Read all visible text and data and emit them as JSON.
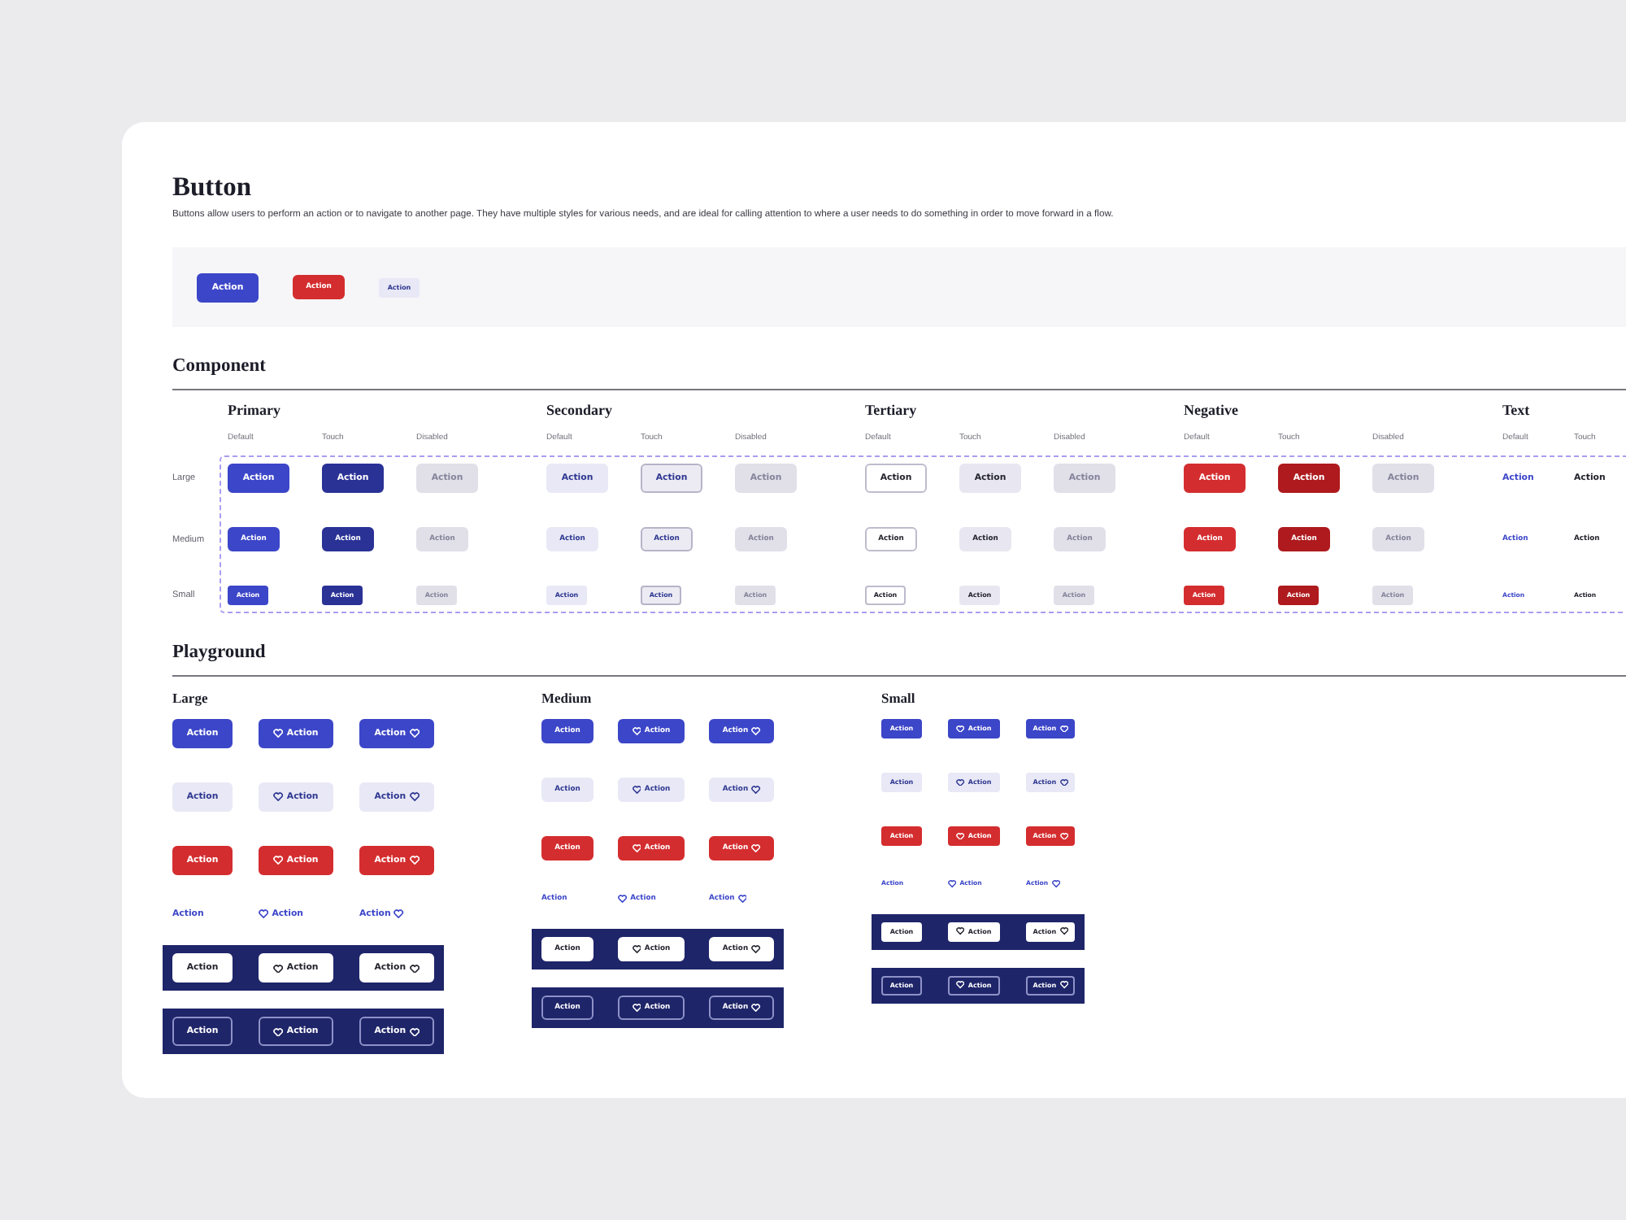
{
  "title": "Button",
  "description": "Buttons allow users to perform an action or to navigate to another page. They have multiple styles for various needs, and are ideal for calling attention to where a user needs to do something in order to move forward in a flow.",
  "preview": {
    "buttons": [
      {
        "label": "Action",
        "kind": "primary_large"
      },
      {
        "label": "Action",
        "kind": "negative_medium"
      },
      {
        "label": "Action",
        "kind": "secondary_small"
      }
    ]
  },
  "component": {
    "heading": "Component",
    "sizes": [
      {
        "label": "Large",
        "kind": "large"
      },
      {
        "label": "Medium",
        "kind": "medium"
      },
      {
        "label": "Small",
        "kind": "small"
      }
    ],
    "groups": [
      {
        "title": "Primary",
        "kind": "primary",
        "columns": [
          {
            "label": "Default",
            "kind": "default",
            "buttons": [
              "Action",
              "Action",
              "Action"
            ]
          },
          {
            "label": "Touch",
            "kind": "touch",
            "buttons": [
              "Action",
              "Action",
              "Action"
            ]
          },
          {
            "label": "Disabled",
            "kind": "disabled",
            "buttons": [
              "Action",
              "Action",
              "Action"
            ]
          }
        ]
      },
      {
        "title": "Secondary",
        "kind": "secondary",
        "columns": [
          {
            "label": "Default",
            "kind": "default",
            "buttons": [
              "Action",
              "Action",
              "Action"
            ]
          },
          {
            "label": "Touch",
            "kind": "touch",
            "buttons": [
              "Action",
              "Action",
              "Action"
            ]
          },
          {
            "label": "Disabled",
            "kind": "disabled",
            "buttons": [
              "Action",
              "Action",
              "Action"
            ]
          }
        ]
      },
      {
        "title": "Tertiary",
        "kind": "tertiary",
        "columns": [
          {
            "label": "Default",
            "kind": "default",
            "buttons": [
              "Action",
              "Action",
              "Action"
            ]
          },
          {
            "label": "Touch",
            "kind": "touch",
            "buttons": [
              "Action",
              "Action",
              "Action"
            ]
          },
          {
            "label": "Disabled",
            "kind": "disabled",
            "buttons": [
              "Action",
              "Action",
              "Action"
            ]
          }
        ]
      },
      {
        "title": "Negative",
        "kind": "negative",
        "columns": [
          {
            "label": "Default",
            "kind": "default",
            "buttons": [
              "Action",
              "Action",
              "Action"
            ]
          },
          {
            "label": "Touch",
            "kind": "touch",
            "buttons": [
              "Action",
              "Action",
              "Action"
            ]
          },
          {
            "label": "Disabled",
            "kind": "disabled",
            "buttons": [
              "Action",
              "Action",
              "Action"
            ]
          }
        ]
      },
      {
        "title": "Text",
        "kind": "text",
        "columns": [
          {
            "label": "Default",
            "kind": "default",
            "buttons": [
              "Action",
              "Action",
              "Action"
            ]
          },
          {
            "label": "Touch",
            "kind": "touch",
            "buttons": [
              "Action",
              "Action",
              "Action"
            ]
          }
        ]
      }
    ]
  },
  "playground": {
    "heading": "Playground",
    "columns": [
      {
        "title": "Large",
        "kind": "large",
        "rows": [
          {
            "kind": "primary",
            "buttons": [
              {
                "label": "Action",
                "kind": "label_only"
              },
              {
                "label": "Action",
                "kind": "icon_left"
              },
              {
                "label": "Action",
                "kind": "icon_right"
              }
            ]
          },
          {
            "kind": "secondary",
            "buttons": [
              {
                "label": "Action",
                "kind": "label_only"
              },
              {
                "label": "Action",
                "kind": "icon_left"
              },
              {
                "label": "Action",
                "kind": "icon_right"
              }
            ]
          },
          {
            "kind": "negative",
            "buttons": [
              {
                "label": "Action",
                "kind": "label_only"
              },
              {
                "label": "Action",
                "kind": "icon_left"
              },
              {
                "label": "Action",
                "kind": "icon_right"
              }
            ]
          },
          {
            "kind": "text",
            "buttons": [
              {
                "label": "Action",
                "kind": "label_only"
              },
              {
                "label": "Action",
                "kind": "icon_left"
              },
              {
                "label": "Action",
                "kind": "icon_right"
              }
            ]
          },
          {
            "kind": "inverse",
            "buttons": [
              {
                "label": "Action",
                "kind": "label_only"
              },
              {
                "label": "Action",
                "kind": "icon_left"
              },
              {
                "label": "Action",
                "kind": "icon_right"
              }
            ]
          },
          {
            "kind": "inverse_outline",
            "buttons": [
              {
                "label": "Action",
                "kind": "label_only"
              },
              {
                "label": "Action",
                "kind": "icon_left"
              },
              {
                "label": "Action",
                "kind": "icon_right"
              }
            ]
          }
        ]
      },
      {
        "title": "Medium",
        "kind": "medium",
        "rows": [
          {
            "kind": "primary",
            "buttons": [
              {
                "label": "Action",
                "kind": "label_only"
              },
              {
                "label": "Action",
                "kind": "icon_left"
              },
              {
                "label": "Action",
                "kind": "icon_right"
              }
            ]
          },
          {
            "kind": "secondary",
            "buttons": [
              {
                "label": "Action",
                "kind": "label_only"
              },
              {
                "label": "Action",
                "kind": "icon_left"
              },
              {
                "label": "Action",
                "kind": "icon_right"
              }
            ]
          },
          {
            "kind": "negative",
            "buttons": [
              {
                "label": "Action",
                "kind": "label_only"
              },
              {
                "label": "Action",
                "kind": "icon_left"
              },
              {
                "label": "Action",
                "kind": "icon_right"
              }
            ]
          },
          {
            "kind": "text",
            "buttons": [
              {
                "label": "Action",
                "kind": "label_only"
              },
              {
                "label": "Action",
                "kind": "icon_left"
              },
              {
                "label": "Action",
                "kind": "icon_right"
              }
            ]
          },
          {
            "kind": "inverse",
            "buttons": [
              {
                "label": "Action",
                "kind": "label_only"
              },
              {
                "label": "Action",
                "kind": "icon_left"
              },
              {
                "label": "Action",
                "kind": "icon_right"
              }
            ]
          },
          {
            "kind": "inverse_outline",
            "buttons": [
              {
                "label": "Action",
                "kind": "label_only"
              },
              {
                "label": "Action",
                "kind": "icon_left"
              },
              {
                "label": "Action",
                "kind": "icon_right"
              }
            ]
          }
        ]
      },
      {
        "title": "Small",
        "kind": "small",
        "rows": [
          {
            "kind": "primary",
            "buttons": [
              {
                "label": "Action",
                "kind": "label_only"
              },
              {
                "label": "Action",
                "kind": "icon_left"
              },
              {
                "label": "Action",
                "kind": "icon_right"
              }
            ]
          },
          {
            "kind": "secondary",
            "buttons": [
              {
                "label": "Action",
                "kind": "label_only"
              },
              {
                "label": "Action",
                "kind": "icon_left"
              },
              {
                "label": "Action",
                "kind": "icon_right"
              }
            ]
          },
          {
            "kind": "negative",
            "buttons": [
              {
                "label": "Action",
                "kind": "label_only"
              },
              {
                "label": "Action",
                "kind": "icon_left"
              },
              {
                "label": "Action",
                "kind": "icon_right"
              }
            ]
          },
          {
            "kind": "text",
            "buttons": [
              {
                "label": "Action",
                "kind": "label_only"
              },
              {
                "label": "Action",
                "kind": "icon_left"
              },
              {
                "label": "Action",
                "kind": "icon_right"
              }
            ]
          },
          {
            "kind": "inverse",
            "buttons": [
              {
                "label": "Action",
                "kind": "label_only"
              },
              {
                "label": "Action",
                "kind": "icon_left"
              },
              {
                "label": "Action",
                "kind": "icon_right"
              }
            ]
          },
          {
            "kind": "inverse_outline",
            "buttons": [
              {
                "label": "Action",
                "kind": "label_only"
              },
              {
                "label": "Action",
                "kind": "icon_left"
              },
              {
                "label": "Action",
                "kind": "icon_right"
              }
            ]
          }
        ]
      }
    ]
  }
}
